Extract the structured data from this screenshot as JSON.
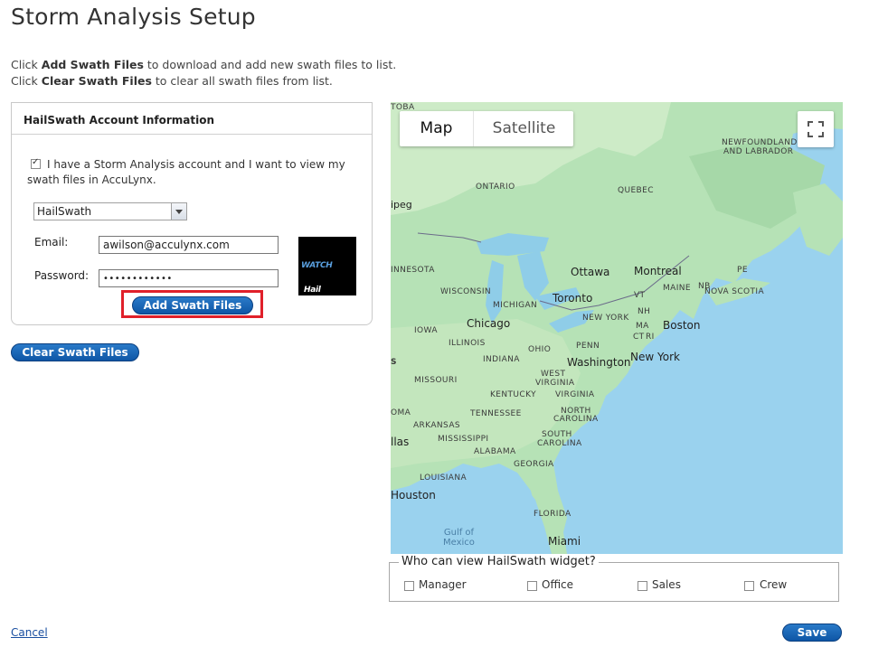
{
  "page": {
    "title": "Storm Analysis Setup",
    "help_line1": {
      "prefix": "Click ",
      "strong": "Add Swath Files",
      "suffix": " to download and add new swath files to list."
    },
    "help_line2": {
      "prefix": "Click ",
      "strong": "Clear Swath Files",
      "suffix": " to clear all swath files from list."
    }
  },
  "account": {
    "header": "HailSwath Account Information",
    "owns_account_label": "I have a Storm Analysis account and I want to view my swath files in AccuLynx.",
    "owns_account_checked": true,
    "provider_selected": "HailSwath",
    "email_label": "Email:",
    "email_value": "awilson@acculynx.com",
    "password_label": "Password:",
    "password_value": "••••••••••••",
    "logo_text_a": "Hail",
    "logo_text_b": "WATCH",
    "add_button": "Add Swath Files"
  },
  "clear_button": "Clear Swath Files",
  "map": {
    "map_tab": "Map",
    "satellite_tab": "Satellite",
    "labels": {
      "toba": "TOBA",
      "ontario": "ONTARIO",
      "quebec": "QUEBEC",
      "newfoundland1": "NEWFOUNDLAND",
      "newfoundland2": "AND LABRADOR",
      "ipeg": "ipeg",
      "minnesota": "INNESOTA",
      "wisconsin": "WISCONSIN",
      "michigan": "MICHIGAN",
      "iowa": "IOWA",
      "illinois": "ILLINOIS",
      "indiana": "INDIANA",
      "ohio": "OHIO",
      "penn": "PENN",
      "newyork_state": "NEW YORK",
      "vt": "VT",
      "nh": "NH",
      "maine": "MAINE",
      "ma": "MA",
      "ct": "CT",
      "ri": "RI",
      "pe": "PE",
      "nb": "NB",
      "novascotia": "NOVA SCOTIA",
      "missouri": "MISSOURI",
      "kentucky": "KENTUCKY",
      "westvirginia1": "WEST",
      "westvirginia2": "VIRGINIA",
      "virginia": "VIRGINIA",
      "tennessee": "TENNESSEE",
      "northcarolina1": "NORTH",
      "northcarolina2": "CAROLINA",
      "arkansas": "ARKANSAS",
      "mississippi": "MISSISSIPPI",
      "southcarolina1": "SOUTH",
      "southcarolina2": "CAROLINA",
      "alabama": "ALABAMA",
      "georgia": "GEORGIA",
      "louisiana": "LOUISIANA",
      "florida": "FLORIDA",
      "oma": "OMA",
      "s": "S"
    },
    "cities": {
      "ottawa": "Ottawa",
      "montreal": "Montreal",
      "toronto": "Toronto",
      "boston": "Boston",
      "chicago": "Chicago",
      "newyork": "New York",
      "washington": "Washington",
      "dallas": "llas",
      "houston": "Houston",
      "miami": "Miami"
    },
    "water": {
      "gulf1": "Gulf of",
      "gulf2": "Mexico"
    }
  },
  "viewers": {
    "legend": "Who can view HailSwath widget?",
    "roles": [
      "Manager",
      "Office",
      "Sales",
      "Crew"
    ]
  },
  "cancel_link": "Cancel",
  "save_button": "Save"
}
